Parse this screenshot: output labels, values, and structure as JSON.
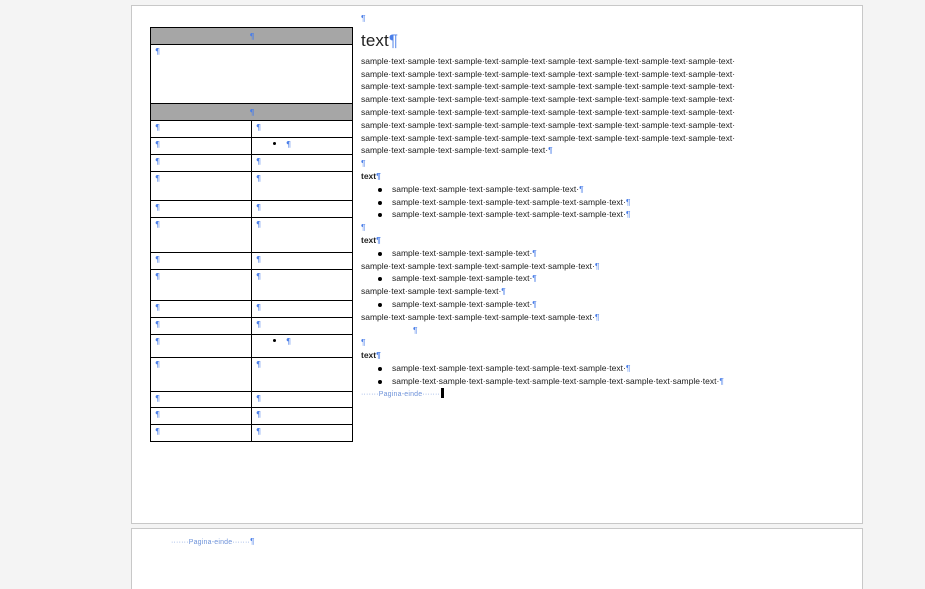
{
  "pilcrow": "¶",
  "page_break_label": "·······Pagina-einde·······",
  "side_table": {
    "header1": "¶",
    "header2": "¶"
  },
  "doc": {
    "title": "text",
    "paragraph": "sample·text·sample·text·sample·text·sample·text·sample·text·sample·text·sample·text·sample·text· sample·text·sample·text·sample·text·sample·text·sample·text·sample·text·sample·text·sample·text· sample·text·sample·text·sample·text·sample·text·sample·text·sample·text·sample·text·sample·text· sample·text·sample·text·sample·text·sample·text·sample·text·sample·text·sample·text·sample·text· sample·text·sample·text·sample·text·sample·text·sample·text·sample·text·sample·text·sample·text· sample·text·sample·text·sample·text·sample·text·sample·text·sample·text·sample·text·sample·text· sample·text·sample·text·sample·text·sample·text·sample·text·sample·text·sample·text·sample·text· sample·text·sample·text·sample·text·sample·text·",
    "section1": {
      "heading": "text",
      "bullets": [
        "sample·text·sample·text·sample·text·sample·text·",
        "sample·text·sample·text·sample·text·sample·text·sample·text·",
        "sample·text·sample·text·sample·text·sample·text·sample·text·"
      ]
    },
    "section2": {
      "heading": "text",
      "bullet_a": "sample·text·sample·text·sample·text·",
      "line_a": "sample·text·sample·text·sample·text·sample·text·sample·text·",
      "bullet_b": "sample·text·sample·text·sample·text·",
      "line_b": "sample·text·sample·text·sample·text·",
      "bullet_c": "sample·text·sample·text·sample·text·",
      "line_c": "sample·text·sample·text·sample·text·sample·text·sample·text·"
    },
    "section3": {
      "heading": "text",
      "bullets": [
        "sample·text·sample·text·sample·text·sample·text·sample·text·",
        "sample·text·sample·text·sample·text·sample·text·sample·text·sample·text·sample·text·"
      ]
    }
  }
}
